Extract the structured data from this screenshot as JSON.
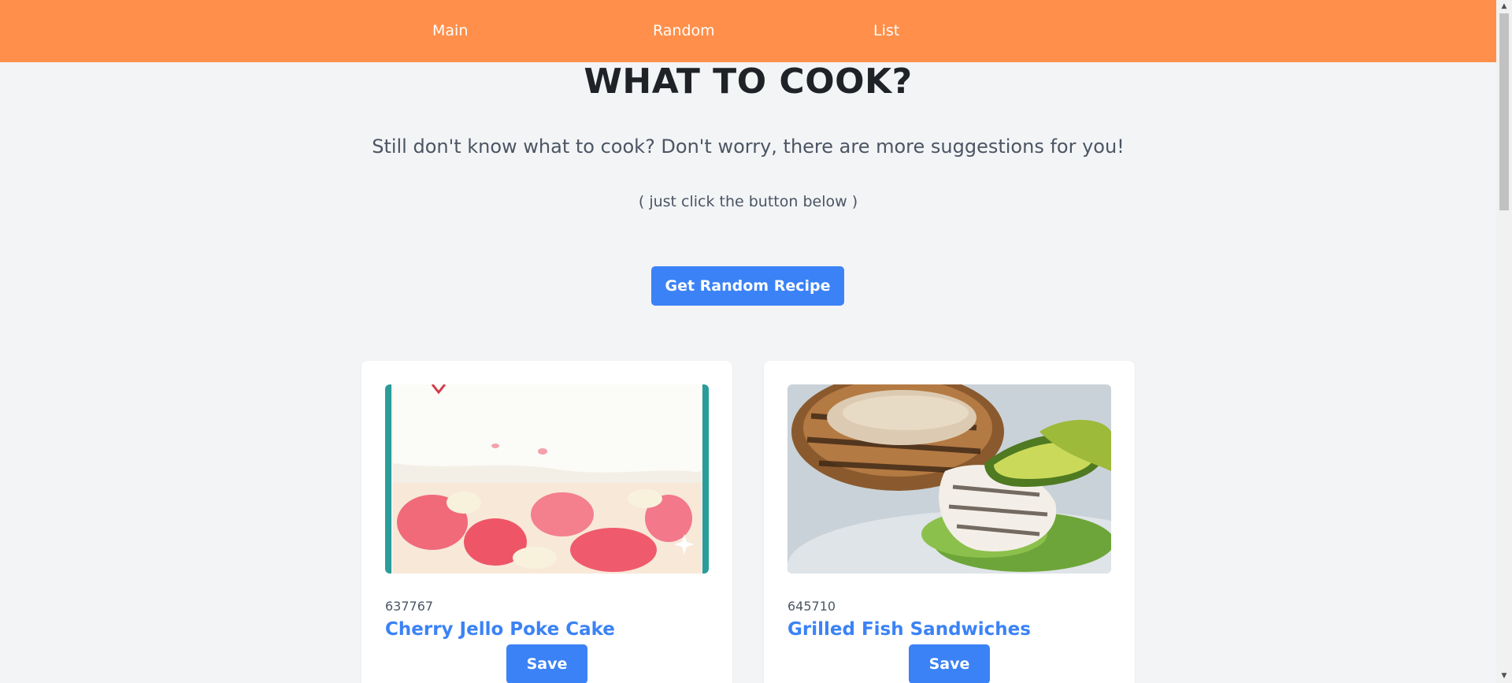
{
  "nav": {
    "items": [
      {
        "label": "Main"
      },
      {
        "label": "Random"
      },
      {
        "label": "List"
      }
    ]
  },
  "hero": {
    "title": "WHAT TO COOK?",
    "subtitle": "Still don't know what to cook? Don't worry, there are more suggestions for you!",
    "hint": "( just click the button below )",
    "button_label": "Get Random Recipe"
  },
  "recipes": [
    {
      "id": "637767",
      "title": "Cherry Jello Poke Cake",
      "save_label": "Save"
    },
    {
      "id": "645710",
      "title": "Grilled Fish Sandwiches",
      "save_label": "Save"
    }
  ],
  "colors": {
    "nav_bg": "#ff8f4a",
    "accent": "#3b82f6",
    "page_bg": "#f3f4f6"
  }
}
